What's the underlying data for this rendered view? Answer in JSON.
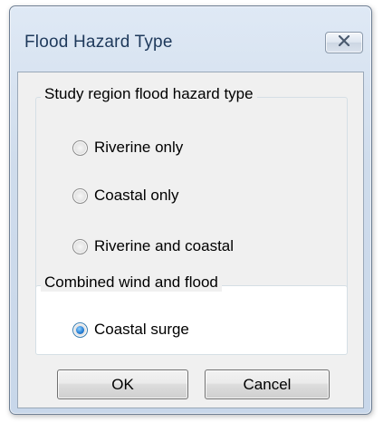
{
  "window": {
    "title": "Flood Hazard Type"
  },
  "group_hazard": {
    "legend": "Study region flood hazard type",
    "options": [
      {
        "label": "Riverine only",
        "checked": false
      },
      {
        "label": "Coastal only",
        "checked": false
      },
      {
        "label": "Riverine and coastal",
        "checked": false
      }
    ]
  },
  "group_combined": {
    "legend": "Combined wind and flood",
    "options": [
      {
        "label": "Coastal surge",
        "checked": true
      }
    ]
  },
  "buttons": {
    "ok": "OK",
    "cancel": "Cancel"
  },
  "icons": {
    "close": "close-icon"
  },
  "colors": {
    "title_text": "#1e395b",
    "radio_selected": "#2a82d8"
  }
}
